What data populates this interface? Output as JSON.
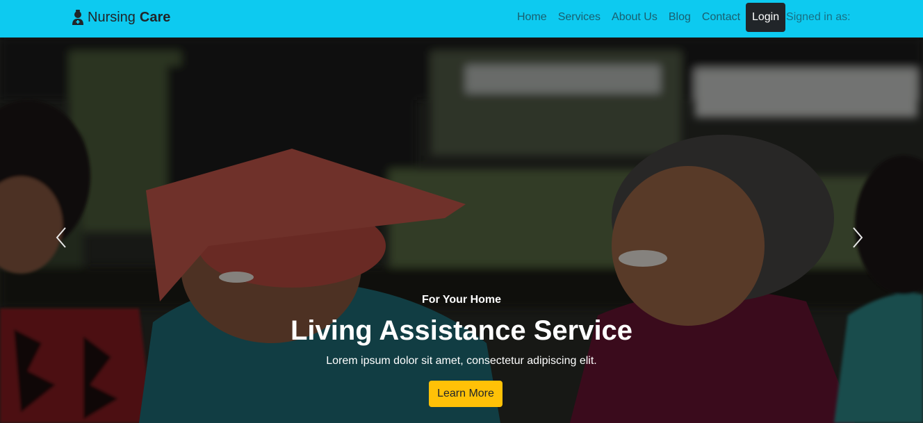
{
  "navbar": {
    "brand_prefix": "Nursing",
    "brand_bold": "Care",
    "links": [
      "Home",
      "Services",
      "About Us",
      "Blog",
      "Contact"
    ],
    "login_label": "Login",
    "signed_in_label": "Signed in as:",
    "background_color": "#0dcaf0"
  },
  "hero": {
    "kicker": "For Your Home",
    "title": "Living Assistance Service",
    "text": "Lorem ipsum dolor sit amet, consectetur adipiscing elit.",
    "cta_label": "Learn More",
    "cta_color": "#ffc107",
    "prev_icon": "chevron-left-icon",
    "next_icon": "chevron-right-icon"
  }
}
